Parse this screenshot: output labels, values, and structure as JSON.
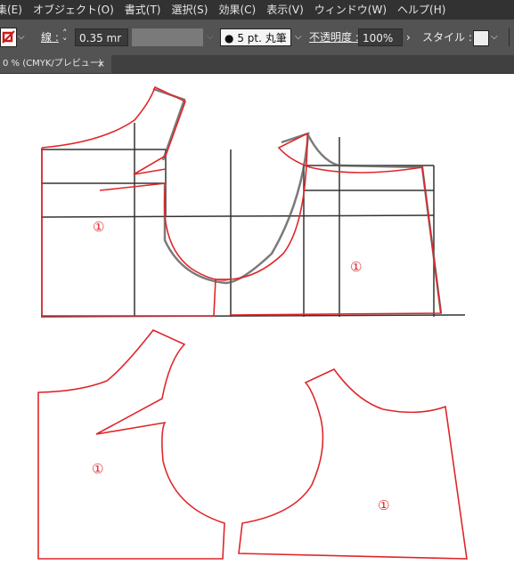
{
  "menubar": {
    "items": [
      "集(E)",
      "オブジェクト(O)",
      "書式(T)",
      "選択(S)",
      "効果(C)",
      "表示(V)",
      "ウィンドウ(W)",
      "ヘルプ(H)"
    ]
  },
  "controlbar": {
    "stroke_label": "線 :",
    "stroke_value": "0.35 mr",
    "brush_label": "5 pt. 丸筆",
    "opacity_label": "不透明度 :",
    "opacity_value": "100%",
    "style_label": "スタイル :"
  },
  "document_tab": {
    "title": "0 % (CMYK/プレビュー)",
    "close_symbol": "×"
  },
  "artwork": {
    "piece_marks": [
      "①",
      "①",
      "①",
      "①"
    ],
    "stroke_color": "#e0262a",
    "sketch_color": "#555555"
  }
}
